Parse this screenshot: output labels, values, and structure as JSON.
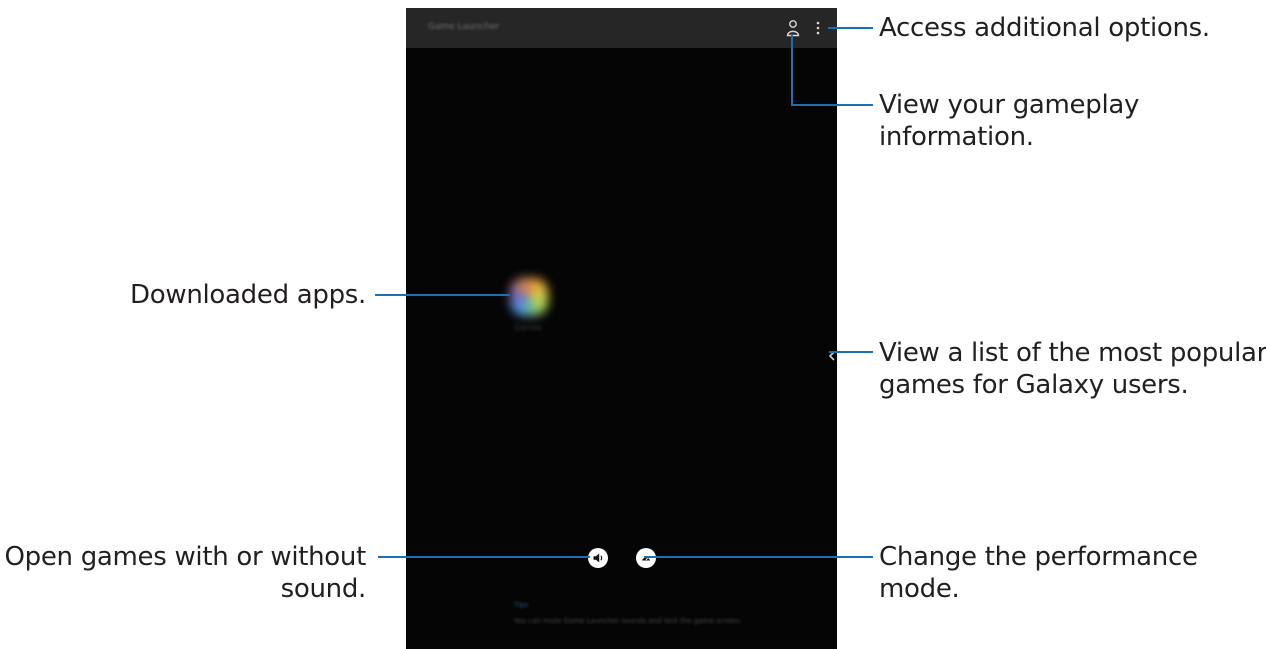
{
  "screen": {
    "title": "Game Launcher",
    "app_label": "Games",
    "tip_title": "Tips",
    "tip_body": "You can mute Game Launcher sounds and lock the game screen."
  },
  "callouts": {
    "more_options": "Access additional options.",
    "gameplay_info_line1": "View your gameplay",
    "gameplay_info_line2": "information.",
    "downloaded_apps": "Downloaded apps.",
    "popular_games_line1": "View a list of the most popular",
    "popular_games_line2": "games for Galaxy users.",
    "sound_line1": "Open games with or without",
    "sound_line2": "sound.",
    "performance_line1": "Change the performance",
    "performance_line2": "mode."
  },
  "colors": {
    "callout_line": "#1b6fb5",
    "screen_bg": "#050505",
    "topbar_bg": "#262626"
  },
  "icons": {
    "profile": "person-icon",
    "more": "more-vertical-icon",
    "sound": "speaker-icon",
    "performance": "speedometer-icon",
    "popular": "chevron-left-icon"
  }
}
